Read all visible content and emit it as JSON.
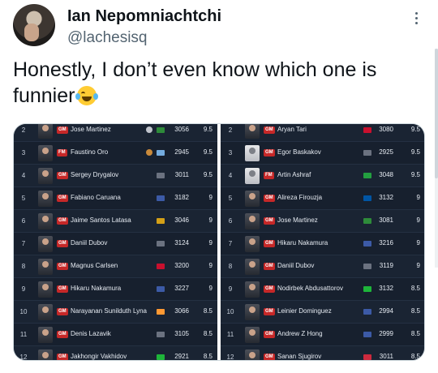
{
  "tweet": {
    "author_name": "Ian Nepomniachtchi",
    "author_handle": "@lachesisq",
    "text": "Honestly, I don’t even know which one is funnier",
    "emoji": "face-with-tears-of-joy"
  },
  "colors": {
    "panel_bg": "#17202e",
    "title_badge": "#c62828",
    "text_primary": "#0f1419",
    "text_secondary": "#536471"
  },
  "left_table": {
    "rows": [
      {
        "rank": "2",
        "title": "GM",
        "name": "Jose Martinez",
        "medal": "silver",
        "flag_color": "#2e8b3a",
        "rating": "3056",
        "score": "9.5"
      },
      {
        "rank": "3",
        "title": "FM",
        "name": "Faustino Oro",
        "medal": "bronze",
        "flag_color": "#74acdf",
        "rating": "2945",
        "score": "9.5"
      },
      {
        "rank": "4",
        "title": "GM",
        "name": "Sergey Drygalov",
        "medal": "",
        "flag_color": "#6b7280",
        "rating": "3011",
        "score": "9.5"
      },
      {
        "rank": "5",
        "title": "GM",
        "name": "Fabiano Caruana",
        "medal": "",
        "flag_color": "#3c5aa6",
        "rating": "3182",
        "score": "9"
      },
      {
        "rank": "6",
        "title": "GM",
        "name": "Jaime Santos Latasa",
        "medal": "",
        "flag_color": "#d4a017",
        "rating": "3046",
        "score": "9"
      },
      {
        "rank": "7",
        "title": "GM",
        "name": "Daniil Dubov",
        "medal": "",
        "flag_color": "#6b7280",
        "rating": "3124",
        "score": "9"
      },
      {
        "rank": "8",
        "title": "GM",
        "name": "Magnus Carlsen",
        "medal": "",
        "flag_color": "#c8102e",
        "rating": "3200",
        "score": "9"
      },
      {
        "rank": "9",
        "title": "GM",
        "name": "Hikaru Nakamura",
        "medal": "",
        "flag_color": "#3c5aa6",
        "rating": "3227",
        "score": "9"
      },
      {
        "rank": "10",
        "title": "GM",
        "name": "Narayanan Sunilduth Lyna",
        "medal": "",
        "flag_color": "#ff9933",
        "rating": "3066",
        "score": "8.5"
      },
      {
        "rank": "11",
        "title": "GM",
        "name": "Denis Lazavik",
        "medal": "",
        "flag_color": "#6b7280",
        "rating": "3105",
        "score": "8.5"
      },
      {
        "rank": "12",
        "title": "GM",
        "name": "Jakhongir Vakhidov",
        "medal": "",
        "flag_color": "#1eb53a",
        "rating": "2921",
        "score": "8.5"
      }
    ]
  },
  "right_table": {
    "rows": [
      {
        "rank": "2",
        "title": "GM",
        "name": "Aryan Tari",
        "silhouette": false,
        "flag_color": "#c8102e",
        "rating": "3080",
        "score": "9.5"
      },
      {
        "rank": "3",
        "title": "GM",
        "name": "Egor Baskakov",
        "silhouette": true,
        "flag_color": "#6b7280",
        "rating": "2925",
        "score": "9.5"
      },
      {
        "rank": "4",
        "title": "FM",
        "name": "Artin Ashraf",
        "silhouette": true,
        "flag_color": "#239f40",
        "rating": "3048",
        "score": "9.5"
      },
      {
        "rank": "5",
        "title": "GM",
        "name": "Alireza Firouzja",
        "silhouette": false,
        "flag_color": "#0055a4",
        "rating": "3132",
        "score": "9"
      },
      {
        "rank": "6",
        "title": "GM",
        "name": "Jose Martinez",
        "silhouette": false,
        "flag_color": "#2e8b3a",
        "rating": "3081",
        "score": "9"
      },
      {
        "rank": "7",
        "title": "GM",
        "name": "Hikaru Nakamura",
        "silhouette": false,
        "flag_color": "#3c5aa6",
        "rating": "3216",
        "score": "9"
      },
      {
        "rank": "8",
        "title": "GM",
        "name": "Daniil Dubov",
        "silhouette": false,
        "flag_color": "#6b7280",
        "rating": "3119",
        "score": "9"
      },
      {
        "rank": "9",
        "title": "GM",
        "name": "Nodirbek Abdusattorov",
        "silhouette": false,
        "flag_color": "#1eb53a",
        "rating": "3132",
        "score": "8.5"
      },
      {
        "rank": "10",
        "title": "GM",
        "name": "Leinier Dominguez",
        "silhouette": false,
        "flag_color": "#3c5aa6",
        "rating": "2994",
        "score": "8.5"
      },
      {
        "rank": "11",
        "title": "GM",
        "name": "Andrew Z Hong",
        "silhouette": false,
        "flag_color": "#3c5aa6",
        "rating": "2999",
        "score": "8.5"
      },
      {
        "rank": "12",
        "title": "GM",
        "name": "Sanan Sjugirov",
        "silhouette": false,
        "flag_color": "#cd2a3e",
        "rating": "3011",
        "score": "8.5"
      }
    ]
  }
}
